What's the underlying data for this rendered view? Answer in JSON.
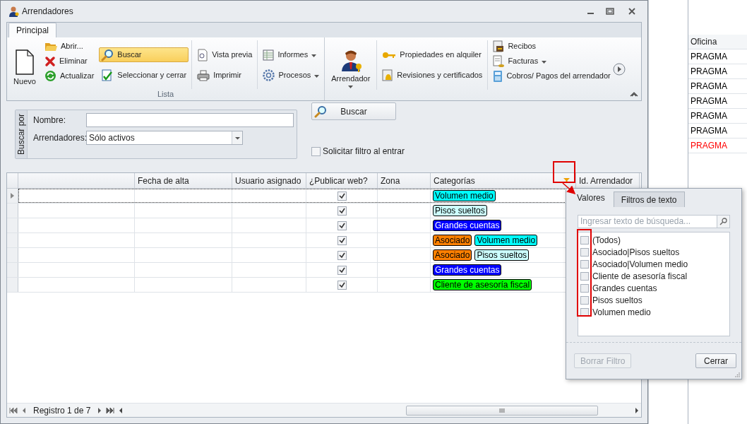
{
  "window": {
    "title": "Arrendadores"
  },
  "ribbon": {
    "tabs": [
      {
        "label": "Principal",
        "selected": true
      }
    ],
    "groups": [
      {
        "label": "Lista",
        "sections": [
          [
            [
              {
                "label": "Nuevo",
                "kind": "large",
                "dropdown": false,
                "highlighted": false
              }
            ],
            [
              {
                "label": "Abrir...",
                "kind": "small",
                "dropdown": false,
                "highlighted": false
              },
              {
                "label": "Eliminar",
                "kind": "small",
                "dropdown": false,
                "highlighted": false
              },
              {
                "label": "Actualizar",
                "kind": "small",
                "dropdown": false,
                "highlighted": false
              }
            ],
            [
              {
                "label": "Buscar",
                "kind": "small",
                "dropdown": false,
                "highlighted": true
              },
              {
                "label": "Seleccionar y cerrar",
                "kind": "small",
                "dropdown": false,
                "highlighted": false
              }
            ]
          ],
          [
            [
              {
                "label": "Vista previa",
                "kind": "small",
                "dropdown": false,
                "highlighted": false
              },
              {
                "label": "Imprimir",
                "kind": "small",
                "dropdown": false,
                "highlighted": false
              }
            ]
          ],
          [
            [
              {
                "label": "Informes",
                "kind": "small",
                "dropdown": true,
                "highlighted": false
              },
              {
                "label": "Procesos",
                "kind": "small",
                "dropdown": true,
                "highlighted": false
              }
            ]
          ]
        ]
      },
      {
        "sections": [
          [
            [
              {
                "label": "Arrendador",
                "kind": "large",
                "dropdown": true,
                "highlighted": false
              }
            ]
          ],
          [
            [
              {
                "label": "Propiedades en alquiler",
                "kind": "small",
                "dropdown": false,
                "highlighted": false
              },
              {
                "label": "Revisiones y certificados",
                "kind": "small",
                "dropdown": false,
                "highlighted": false
              }
            ]
          ],
          [
            [
              {
                "label": "Recibos",
                "kind": "small",
                "dropdown": false,
                "highlighted": false
              },
              {
                "label": "Facturas",
                "kind": "small",
                "dropdown": true,
                "highlighted": false
              },
              {
                "label": "Cobros/ Pagos del arrendador",
                "kind": "small",
                "dropdown": false,
                "highlighted": false
              }
            ]
          ]
        ]
      }
    ]
  },
  "search_panel": {
    "caption": "Buscar por",
    "fields": [
      {
        "label": "Nombre:",
        "kind": "text"
      },
      {
        "label": "Arrendadores:",
        "kind": "combo",
        "value": "Sólo activos"
      }
    ],
    "button": "Buscar",
    "checkbox": {
      "label": "Solicitar filtro al entrar",
      "checked": false
    }
  },
  "grid": {
    "columns": [
      "Fecha de alta",
      "Usuario asignado",
      "¿Publicar web?",
      "Zona",
      "Categorías",
      "Id. Arrendador"
    ],
    "rows": [
      {
        "selected": true,
        "publicar_web": true,
        "categories": [
          {
            "label": "Volumen medio",
            "color": "#00ffff"
          }
        ]
      },
      {
        "selected": false,
        "publicar_web": true,
        "categories": [
          {
            "label": "Pisos sueltos",
            "color": "#ccffff"
          }
        ]
      },
      {
        "selected": false,
        "publicar_web": true,
        "categories": [
          {
            "label": "Grandes cuentas",
            "color": "#0000ff"
          }
        ]
      },
      {
        "selected": false,
        "publicar_web": true,
        "categories": [
          {
            "label": "Asociado",
            "color": "#ff8000"
          },
          {
            "label": "Volumen medio",
            "color": "#00ffff"
          }
        ]
      },
      {
        "selected": false,
        "publicar_web": true,
        "categories": [
          {
            "label": "Asociado",
            "color": "#ff8000"
          },
          {
            "label": "Pisos sueltos",
            "color": "#ccffff"
          }
        ]
      },
      {
        "selected": false,
        "publicar_web": true,
        "categories": [
          {
            "label": "Grandes cuentas",
            "color": "#0000ff"
          }
        ]
      },
      {
        "selected": false,
        "publicar_web": true,
        "categories": [
          {
            "label": "Cliente de asesoría fiscal",
            "color": "#00ff00"
          }
        ]
      }
    ],
    "navigator": "Registro 1 de 7"
  },
  "filter_popup": {
    "tabs": [
      {
        "label": "Valores",
        "selected": true
      },
      {
        "label": "Filtros de texto",
        "selected": false
      }
    ],
    "search_placeholder": "Ingresar texto de búsqueda...",
    "values": [
      {
        "label": "(Todos)",
        "checked": false
      },
      {
        "label": "Asociado|Pisos sueltos",
        "checked": false
      },
      {
        "label": "Asociado|Volumen medio",
        "checked": false
      },
      {
        "label": "Cliente de asesoría fiscal",
        "checked": false
      },
      {
        "label": "Grandes cuentas",
        "checked": false
      },
      {
        "label": "Pisos sueltos",
        "checked": false
      },
      {
        "label": "Volumen medio",
        "checked": false
      }
    ],
    "buttons": [
      {
        "label": "Borrar Filtro",
        "disabled": true
      },
      {
        "label": "Cerrar",
        "disabled": false
      }
    ]
  },
  "background_window": {
    "column": "Oficina",
    "rows": [
      {
        "label": "PRAGMA",
        "color": "#000000"
      },
      {
        "label": "PRAGMA",
        "color": "#000000"
      },
      {
        "label": "PRAGMA",
        "color": "#000000"
      },
      {
        "label": "PRAGMA",
        "color": "#000000"
      },
      {
        "label": "PRAGMA",
        "color": "#000000"
      },
      {
        "label": "PRAGMA",
        "color": "#000000"
      },
      {
        "label": "PRAGMA",
        "color": "#ff0000"
      }
    ]
  }
}
